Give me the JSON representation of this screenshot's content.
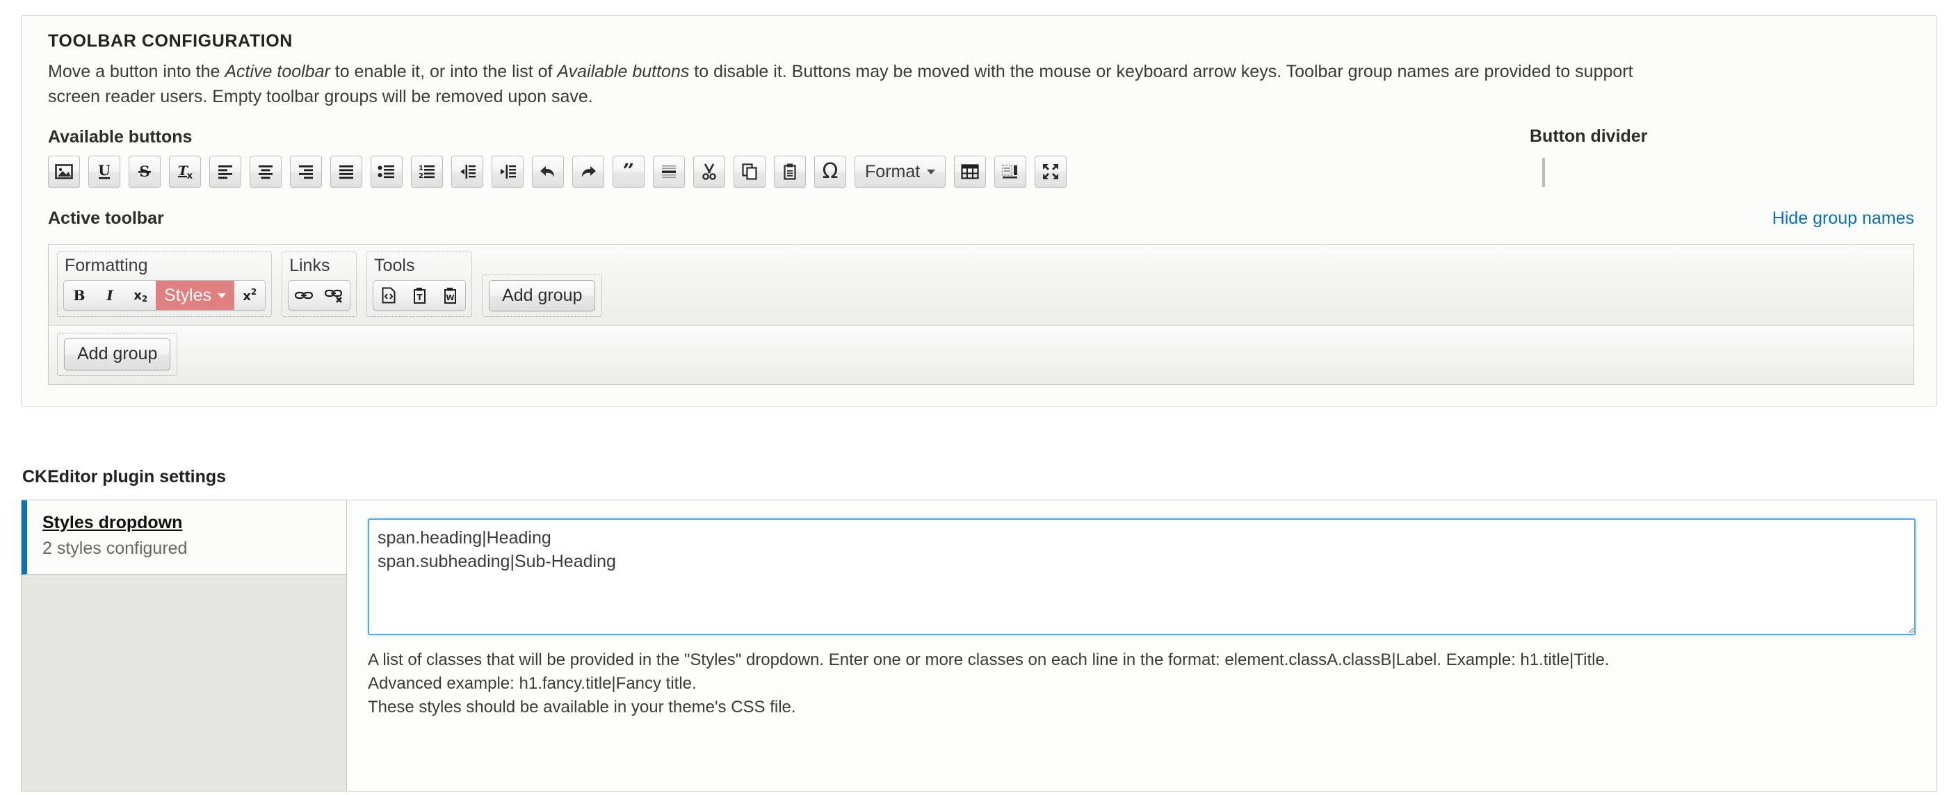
{
  "toolbar_config": {
    "title": "TOOLBAR CONFIGURATION",
    "description": "Move a button into the Active toolbar to enable it, or into the list of Available buttons to disable it. Buttons may be moved with the mouse or keyboard arrow keys. Toolbar group names are provided to support screen reader users. Empty toolbar groups will be removed upon save.",
    "description_em1": "Active toolbar",
    "description_em2": "Available buttons",
    "description_part1": "Move a button into the ",
    "description_part2": " to enable it, or into the list of ",
    "description_part3": " to disable it. Buttons may be moved with the mouse or keyboard arrow keys. Toolbar group names are provided to support",
    "description_part4": "screen reader users. Empty toolbar groups will be removed upon save.",
    "available_label": "Available buttons",
    "available_buttons": [
      {
        "name": "image",
        "label": "Image"
      },
      {
        "name": "underline",
        "label": "Underline"
      },
      {
        "name": "strikethrough",
        "label": "Strike Through"
      },
      {
        "name": "remove-format",
        "label": "Remove Format"
      },
      {
        "name": "align-left",
        "label": "Align Left"
      },
      {
        "name": "align-center",
        "label": "Center"
      },
      {
        "name": "align-right",
        "label": "Align Right"
      },
      {
        "name": "justify",
        "label": "Justify"
      },
      {
        "name": "bullet-list",
        "label": "Insert/Remove Bulleted List"
      },
      {
        "name": "numbered-list",
        "label": "Insert/Remove Numbered List"
      },
      {
        "name": "outdent",
        "label": "Decrease Indent"
      },
      {
        "name": "indent",
        "label": "Increase Indent"
      },
      {
        "name": "undo",
        "label": "Undo"
      },
      {
        "name": "redo",
        "label": "Redo"
      },
      {
        "name": "blockquote",
        "label": "Block Quote"
      },
      {
        "name": "horizontal-rule",
        "label": "Horizontal Rule"
      },
      {
        "name": "cut",
        "label": "Cut"
      },
      {
        "name": "copy",
        "label": "Copy"
      },
      {
        "name": "paste",
        "label": "Paste"
      },
      {
        "name": "special-character",
        "label": "Ω"
      },
      {
        "name": "format-dropdown",
        "label": "Format"
      },
      {
        "name": "table",
        "label": "Table"
      },
      {
        "name": "templates",
        "label": "Templates"
      },
      {
        "name": "maximize",
        "label": "Maximize"
      }
    ],
    "button_divider": {
      "label": "Button divider",
      "name": "divider"
    },
    "active_label": "Active toolbar",
    "hide_group_names_link": "Hide group names",
    "active_rows": [
      {
        "groups": [
          {
            "name": "Formatting",
            "buttons": [
              {
                "name": "bold",
                "label": "B"
              },
              {
                "name": "italic",
                "label": "I"
              },
              {
                "name": "subscript",
                "label": "Subscript"
              },
              {
                "name": "styles-dropdown",
                "label": "Styles",
                "highlighted": true
              },
              {
                "name": "superscript",
                "label": "Superscript"
              }
            ]
          },
          {
            "name": "Links",
            "buttons": [
              {
                "name": "link",
                "label": "Link"
              },
              {
                "name": "unlink",
                "label": "Unlink"
              }
            ]
          },
          {
            "name": "Tools",
            "buttons": [
              {
                "name": "source",
                "label": "Source"
              },
              {
                "name": "paste-text",
                "label": "Paste as plain text"
              },
              {
                "name": "paste-word",
                "label": "Paste from Word"
              }
            ]
          }
        ],
        "add_group_label": "Add group"
      },
      {
        "groups": [],
        "add_group_label": "Add group"
      }
    ]
  },
  "plugin_settings": {
    "title": "CKEditor plugin settings",
    "tabs": [
      {
        "title": "Styles dropdown",
        "summary": "2 styles configured",
        "active": true
      }
    ],
    "styles_field": {
      "value": "span.heading|Heading\nspan.subheading|Sub-Heading",
      "placeholder": "",
      "description_lines": [
        "A list of classes that will be provided in the \"Styles\" dropdown. Enter one or more classes on each line in the format: element.classA.classB|Label. Example: h1.title|Title.",
        "Advanced example: h1.fancy.title|Fancy title.",
        "These styles should be available in your theme's CSS file."
      ]
    }
  },
  "colors": {
    "accent_blue": "#0a72b8",
    "link_blue": "#0a6eb4",
    "highlight_red": "#e08080",
    "focus_blue": "#54a8e8"
  }
}
